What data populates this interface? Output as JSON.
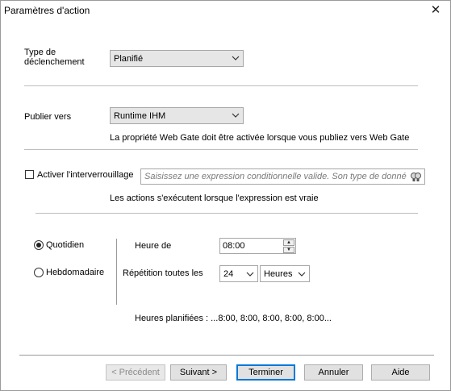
{
  "window": {
    "title": "Paramètres d'action",
    "close_glyph": "✕"
  },
  "trigger": {
    "label": "Type de déclenchement",
    "value": "Planifié"
  },
  "publish": {
    "label": "Publier vers",
    "value": "Runtime IHM",
    "note": "La propriété Web Gate doit être activée lorsque vous publiez vers Web Gate"
  },
  "interlock": {
    "checkbox_label": "Activer l'interverrouillage",
    "checked": false,
    "placeholder": "Saisissez une expression conditionnelle valide. Son type de données",
    "note": "Les actions s'exécutent lorsque l'expression est vraie",
    "icon": "expression-builder-icon"
  },
  "schedule": {
    "daily_label": "Quotidien",
    "weekly_label": "Hebdomadaire",
    "selected": "daily",
    "start_label": "Heure de",
    "start_value": "08:00",
    "repeat_label": "Répétition toutes les",
    "repeat_value": "24",
    "repeat_unit": "Heures",
    "planned_text": "Heures planifiées : ...8:00, 8:00, 8:00, 8:00, 8:00..."
  },
  "buttons": {
    "previous": "< Précédent",
    "next": "Suivant >",
    "finish": "Terminer",
    "cancel": "Annuler",
    "help": "Aide"
  }
}
